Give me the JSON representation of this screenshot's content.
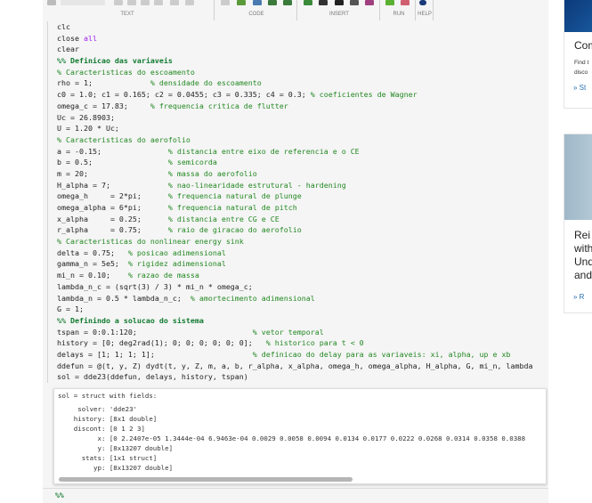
{
  "toolbar": {
    "groups": [
      "TEXT",
      "CODE",
      "INSERT",
      "RUN",
      "HELP"
    ]
  },
  "code": [
    [
      [
        "t",
        "clc"
      ]
    ],
    [
      [
        "t",
        "close "
      ],
      [
        "kw",
        "all"
      ]
    ],
    [
      [
        "t",
        "clear"
      ]
    ],
    [
      [
        "sec",
        "%% Definicao das variaveis"
      ]
    ],
    [
      [
        "cm",
        "% Caracteristicas do escoamento"
      ]
    ],
    [
      [
        "t",
        "rho = 1;             "
      ],
      [
        "cm",
        "% densidade do escoamento"
      ]
    ],
    [
      [
        "t",
        "c0 = 1.0; c1 = 0.165; c2 = 0.0455; c3 = 0.335; c4 = 0.3; "
      ],
      [
        "cm",
        "% coeficientes de Wagner"
      ]
    ],
    [
      [
        "t",
        "omega_c = 17.83;     "
      ],
      [
        "cm",
        "% frequencia critica de flutter"
      ]
    ],
    [
      [
        "t",
        "Uc = 26.8903;"
      ]
    ],
    [
      [
        "t",
        "U = 1.20 * Uc;"
      ]
    ],
    [
      [
        "cm",
        "% Caracteristicas do aerofolio"
      ]
    ],
    [
      [
        "t",
        "a = -0.15;               "
      ],
      [
        "cm",
        "% distancia entre eixo de referencia e o CE"
      ]
    ],
    [
      [
        "t",
        "b = 0.5;                 "
      ],
      [
        "cm",
        "% semicorda"
      ]
    ],
    [
      [
        "t",
        "m = 20;                  "
      ],
      [
        "cm",
        "% massa do aerofolio"
      ]
    ],
    [
      [
        "t",
        "H_alpha = 7;             "
      ],
      [
        "cm",
        "% nao-linearidade estrutural - hardening"
      ]
    ],
    [
      [
        "t",
        "omega_h     = 2*pi;      "
      ],
      [
        "cm",
        "% frequencia natural de plunge"
      ]
    ],
    [
      [
        "t",
        "omega_alpha = 6*pi;      "
      ],
      [
        "cm",
        "% frequencia natural de pitch"
      ]
    ],
    [
      [
        "t",
        "x_alpha     = 0.25;      "
      ],
      [
        "cm",
        "% distancia entre CG e CE"
      ]
    ],
    [
      [
        "t",
        "r_alpha     = 0.75;      "
      ],
      [
        "cm",
        "% raio de giracao do aerofolio"
      ]
    ],
    [
      [
        "cm",
        "% Caracteristicas do nonlinear energy sink"
      ]
    ],
    [
      [
        "t",
        "delta = 0.75;   "
      ],
      [
        "cm",
        "% posicao adimensional"
      ]
    ],
    [
      [
        "t",
        "gamma_n = 5e5;  "
      ],
      [
        "cm",
        "% rigidez adimensional"
      ]
    ],
    [
      [
        "t",
        "mi_n = 0.10;    "
      ],
      [
        "cm",
        "% razao de massa"
      ]
    ],
    [
      [
        "t",
        "lambda_n_c = (sqrt(3) / 3) * mi_n * omega_c;"
      ]
    ],
    [
      [
        "t",
        "lambda_n = 0.5 * lambda_n_c;  "
      ],
      [
        "cm",
        "% amortecimento adimensional"
      ]
    ],
    [
      [
        "t",
        "G = 1;"
      ]
    ],
    [
      [
        "sec",
        "%% Definindo a solucao do sistema"
      ]
    ],
    [
      [
        "t",
        "tspan = 0:0.1:120;                          "
      ],
      [
        "cm",
        "% vetor temporal"
      ]
    ],
    [
      [
        "t",
        "history = [0; deg2rad(1); 0; 0; 0; 0; 0; 0];   "
      ],
      [
        "cm",
        "% historico para t < 0"
      ]
    ],
    [
      [
        "t",
        "delays = [1; 1; 1; 1];                      "
      ],
      [
        "cm",
        "% definicao do delay para as variaveis: xi, alpha, up e xb"
      ]
    ],
    [
      [
        "t",
        "ddefun = @(t, y, Z) dydt(t, y, Z, m, a, b, r_alpha, x_alpha, omega_h, omega_alpha, H_alpha, G, mi_n, lambda"
      ]
    ],
    [
      [
        "t",
        "sol = dde23(ddefun, delays, history, tspan)"
      ]
    ]
  ],
  "output": [
    "sol = struct with fields:",
    "     solver: 'dde23'",
    "    history: [8x1 double]",
    "    discont: [0 1 2 3]",
    "          x: [0 2.2407e-05 1.3444e-04 6.9463e-04 0.0029 0.0058 0.0094 0.0134 0.0177 0.0222 0.0268 0.0314 0.0358 0.0388",
    "          y: [8x13207 double]",
    "      stats: [1x1 struct]",
    "         yp: [8x13207 double]"
  ],
  "next_section": "%%",
  "cards": [
    {
      "title": "Com",
      "desc": [
        "Find t",
        "disco"
      ],
      "link": "» St"
    },
    {
      "title": [
        "Rei",
        "with",
        "Und",
        "and"
      ],
      "link": "» R"
    }
  ]
}
